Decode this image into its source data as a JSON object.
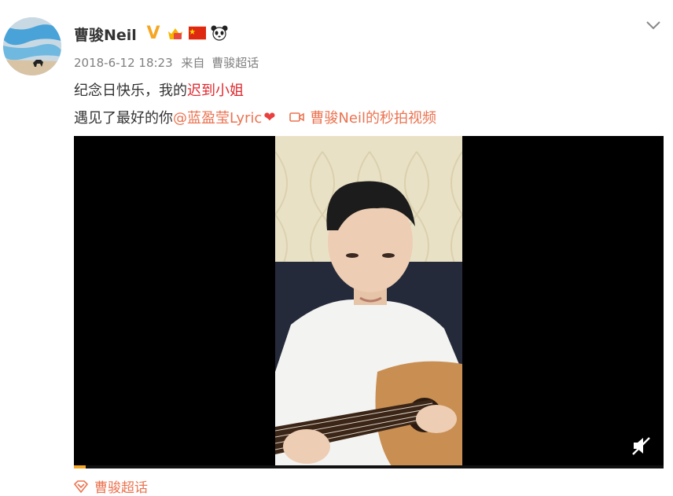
{
  "post": {
    "username": "曹骏Neil",
    "timestamp": "2018-6-12 18:23",
    "source_prefix": "来自",
    "source": "曹骏超话",
    "text_line1_plain": "纪念日快乐，我的",
    "text_line1_link": "迟到小姐",
    "text_line2_plain": "遇见了最好的你",
    "mention": "@蓝盈莹Lyric",
    "heart": "❤",
    "video_link": "曹骏Neil的秒拍视频",
    "topic": "曹骏超话",
    "badges": [
      "verified-v-icon",
      "member-crown-icon",
      "china-flag-icon",
      "panda-icon"
    ]
  },
  "video": {
    "progress_percent": 2
  },
  "colors": {
    "link": "#eb7350",
    "red_text": "#e0262c",
    "verified": "#f5a623"
  }
}
